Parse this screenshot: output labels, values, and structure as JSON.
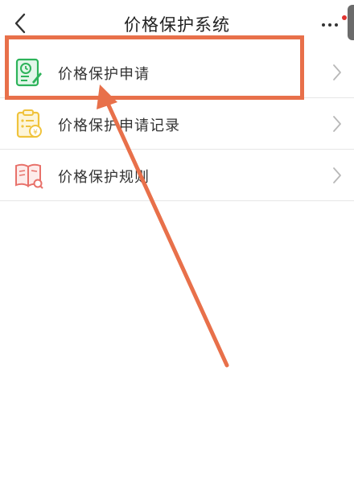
{
  "header": {
    "title": "价格保护系统",
    "back_icon": "chevron-left-icon",
    "more_icon": "more-dots-icon"
  },
  "menu": {
    "items": [
      {
        "label": "价格保护申请",
        "icon": "apply-document-icon",
        "icon_color": "#2db35a"
      },
      {
        "label": "价格保护申请记录",
        "icon": "record-clipboard-icon",
        "icon_color": "#f0c33c"
      },
      {
        "label": "价格保护规则",
        "icon": "rules-book-icon",
        "icon_color": "#e8716a"
      }
    ],
    "chevron_icon": "chevron-right-icon"
  },
  "annotation": {
    "color": "#e8704a",
    "highlighted_item": "价格保护申请"
  },
  "colors": {
    "badge": "#e0322f",
    "divider": "#e6e6e6"
  }
}
